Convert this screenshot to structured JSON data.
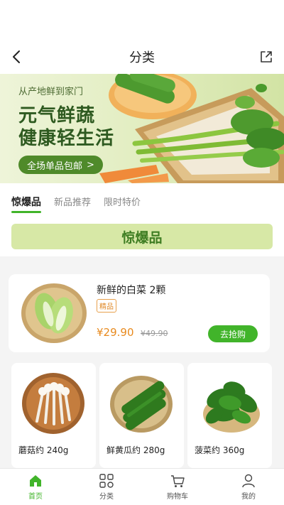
{
  "nav": {
    "title": "分类"
  },
  "banner": {
    "subtitle": "从产地鲜到家门",
    "title_line1": "元气鲜蔬",
    "title_line2": "健康轻生活",
    "button_label": "全场单品包邮",
    "button_arrow": ">"
  },
  "tabs": [
    {
      "label": "惊爆品",
      "active": true
    },
    {
      "label": "新品推荐",
      "active": false
    },
    {
      "label": "限时特价",
      "active": false
    }
  ],
  "section_title": "惊爆品",
  "featured": {
    "name": "新鲜的白菜 2颗",
    "tag": "精品",
    "price": "¥29.90",
    "old_price": "¥49.90",
    "buy_label": "去抢购"
  },
  "products": [
    {
      "name": "蘑菇约 240g",
      "icon": "mushroom"
    },
    {
      "name": "鲜黄瓜约 280g",
      "icon": "cucumber"
    },
    {
      "name": "菠菜约 360g",
      "icon": "spinach"
    }
  ],
  "tabbar": [
    {
      "label": "首页",
      "icon": "home-icon",
      "active": true
    },
    {
      "label": "分类",
      "icon": "category-icon",
      "active": false
    },
    {
      "label": "购物车",
      "icon": "cart-icon",
      "active": false
    },
    {
      "label": "我的",
      "icon": "profile-icon",
      "active": false
    }
  ],
  "colors": {
    "accent": "#41b42a",
    "price": "#e88a1e",
    "brand_dark": "#2e5a20"
  }
}
